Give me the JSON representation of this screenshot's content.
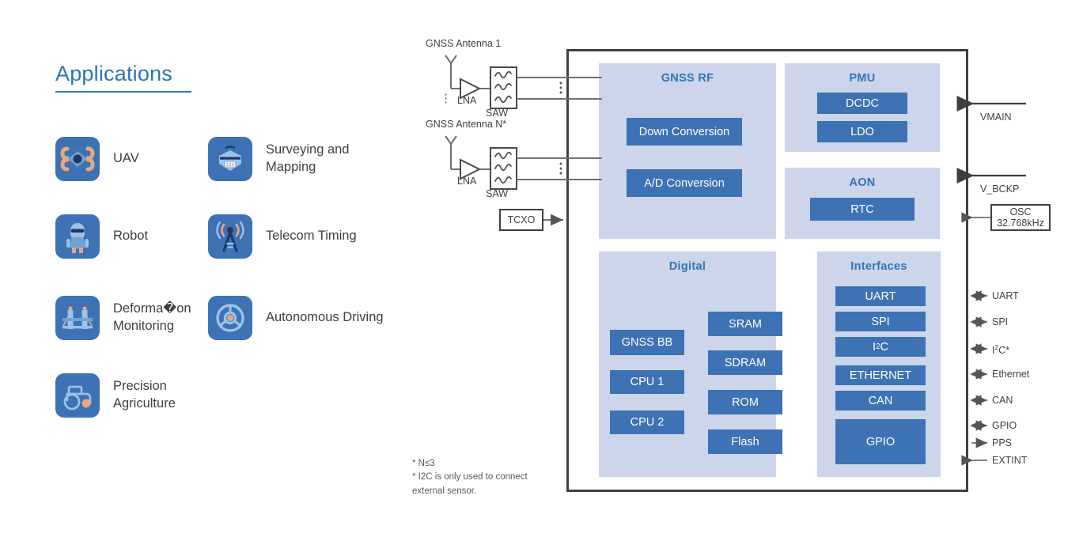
{
  "applications": {
    "title": "Applications",
    "items": [
      {
        "label": "UAV",
        "icon": "drone-icon"
      },
      {
        "label": "Surveying and Mapping",
        "icon": "rtk-receiver-icon"
      },
      {
        "label": "Robot",
        "icon": "robot-icon"
      },
      {
        "label": "Telecom Timing",
        "icon": "antenna-tower-icon"
      },
      {
        "label": "Deforma�on Monitoring",
        "icon": "bridge-icon"
      },
      {
        "label": "Autonomous Driving",
        "icon": "steering-wheel-icon"
      },
      {
        "label": "Precision Agriculture",
        "icon": "tractor-icon"
      }
    ]
  },
  "frontend": {
    "antenna_1_label": "GNSS Antenna 1",
    "antenna_n_label": "GNSS Antenna N*",
    "lna_1_label": "LNA",
    "lna_2_label": "LNA",
    "saw_1_label": "SAW",
    "saw_2_label": "SAW",
    "chain_ellipsis": "⋮",
    "tcxo_label": "TCXO"
  },
  "chip": {
    "groups": [
      {
        "name": "gnss-rf",
        "title": "GNSS RF",
        "blocks": [
          {
            "label": "Down Conversion"
          },
          {
            "label": "A/D Conversion"
          }
        ]
      },
      {
        "name": "pmu",
        "title": "PMU",
        "blocks": [
          {
            "label": "DCDC"
          },
          {
            "label": "LDO"
          }
        ]
      },
      {
        "name": "aon",
        "title": "AON",
        "blocks": [
          {
            "label": "RTC"
          }
        ]
      },
      {
        "name": "digital",
        "title": "Digital",
        "blocks": [
          {
            "label": "GNSS BB"
          },
          {
            "label": "CPU 1"
          },
          {
            "label": "CPU 2"
          },
          {
            "label": "SRAM"
          },
          {
            "label": "SDRAM"
          },
          {
            "label": "ROM"
          },
          {
            "label": "Flash"
          }
        ]
      },
      {
        "name": "interfaces",
        "title": "Interfaces",
        "blocks": [
          {
            "label": "UART"
          },
          {
            "label": "SPI"
          },
          {
            "label": "I2C",
            "html": "I<sup>2</sup>C"
          },
          {
            "label": "ETHERNET"
          },
          {
            "label": "CAN"
          },
          {
            "label": "GPIO"
          }
        ]
      }
    ]
  },
  "external": {
    "power": [
      {
        "label": "VMAIN",
        "direction": "in"
      },
      {
        "label": "V_BCKP",
        "direction": "in"
      }
    ],
    "osc": {
      "line1": "OSC",
      "line2": "32.768kHz"
    },
    "pins": [
      {
        "label": "UART",
        "direction": "bidirectional"
      },
      {
        "label": "SPI",
        "direction": "bidirectional"
      },
      {
        "label": "I2C*",
        "html": "I<sup>2</sup>C*",
        "direction": "bidirectional"
      },
      {
        "label": "Ethernet",
        "direction": "bidirectional"
      },
      {
        "label": "CAN",
        "direction": "bidirectional"
      },
      {
        "label": "GPIO",
        "direction": "bidirectional"
      },
      {
        "label": "PPS",
        "direction": "out"
      },
      {
        "label": "EXTINT",
        "direction": "in"
      }
    ]
  },
  "footnotes": {
    "line1": "* N≤3",
    "line2": "* I2C is only used to connect",
    "line3": "external sensor."
  },
  "colors": {
    "accent_blue": "#2e75b6",
    "block_blue": "#3d72b4",
    "group_fill": "#ccd5ea",
    "icon_orange": "#e8a87c",
    "outline_gray": "#404040",
    "text_gray": "#3f3f3f"
  }
}
